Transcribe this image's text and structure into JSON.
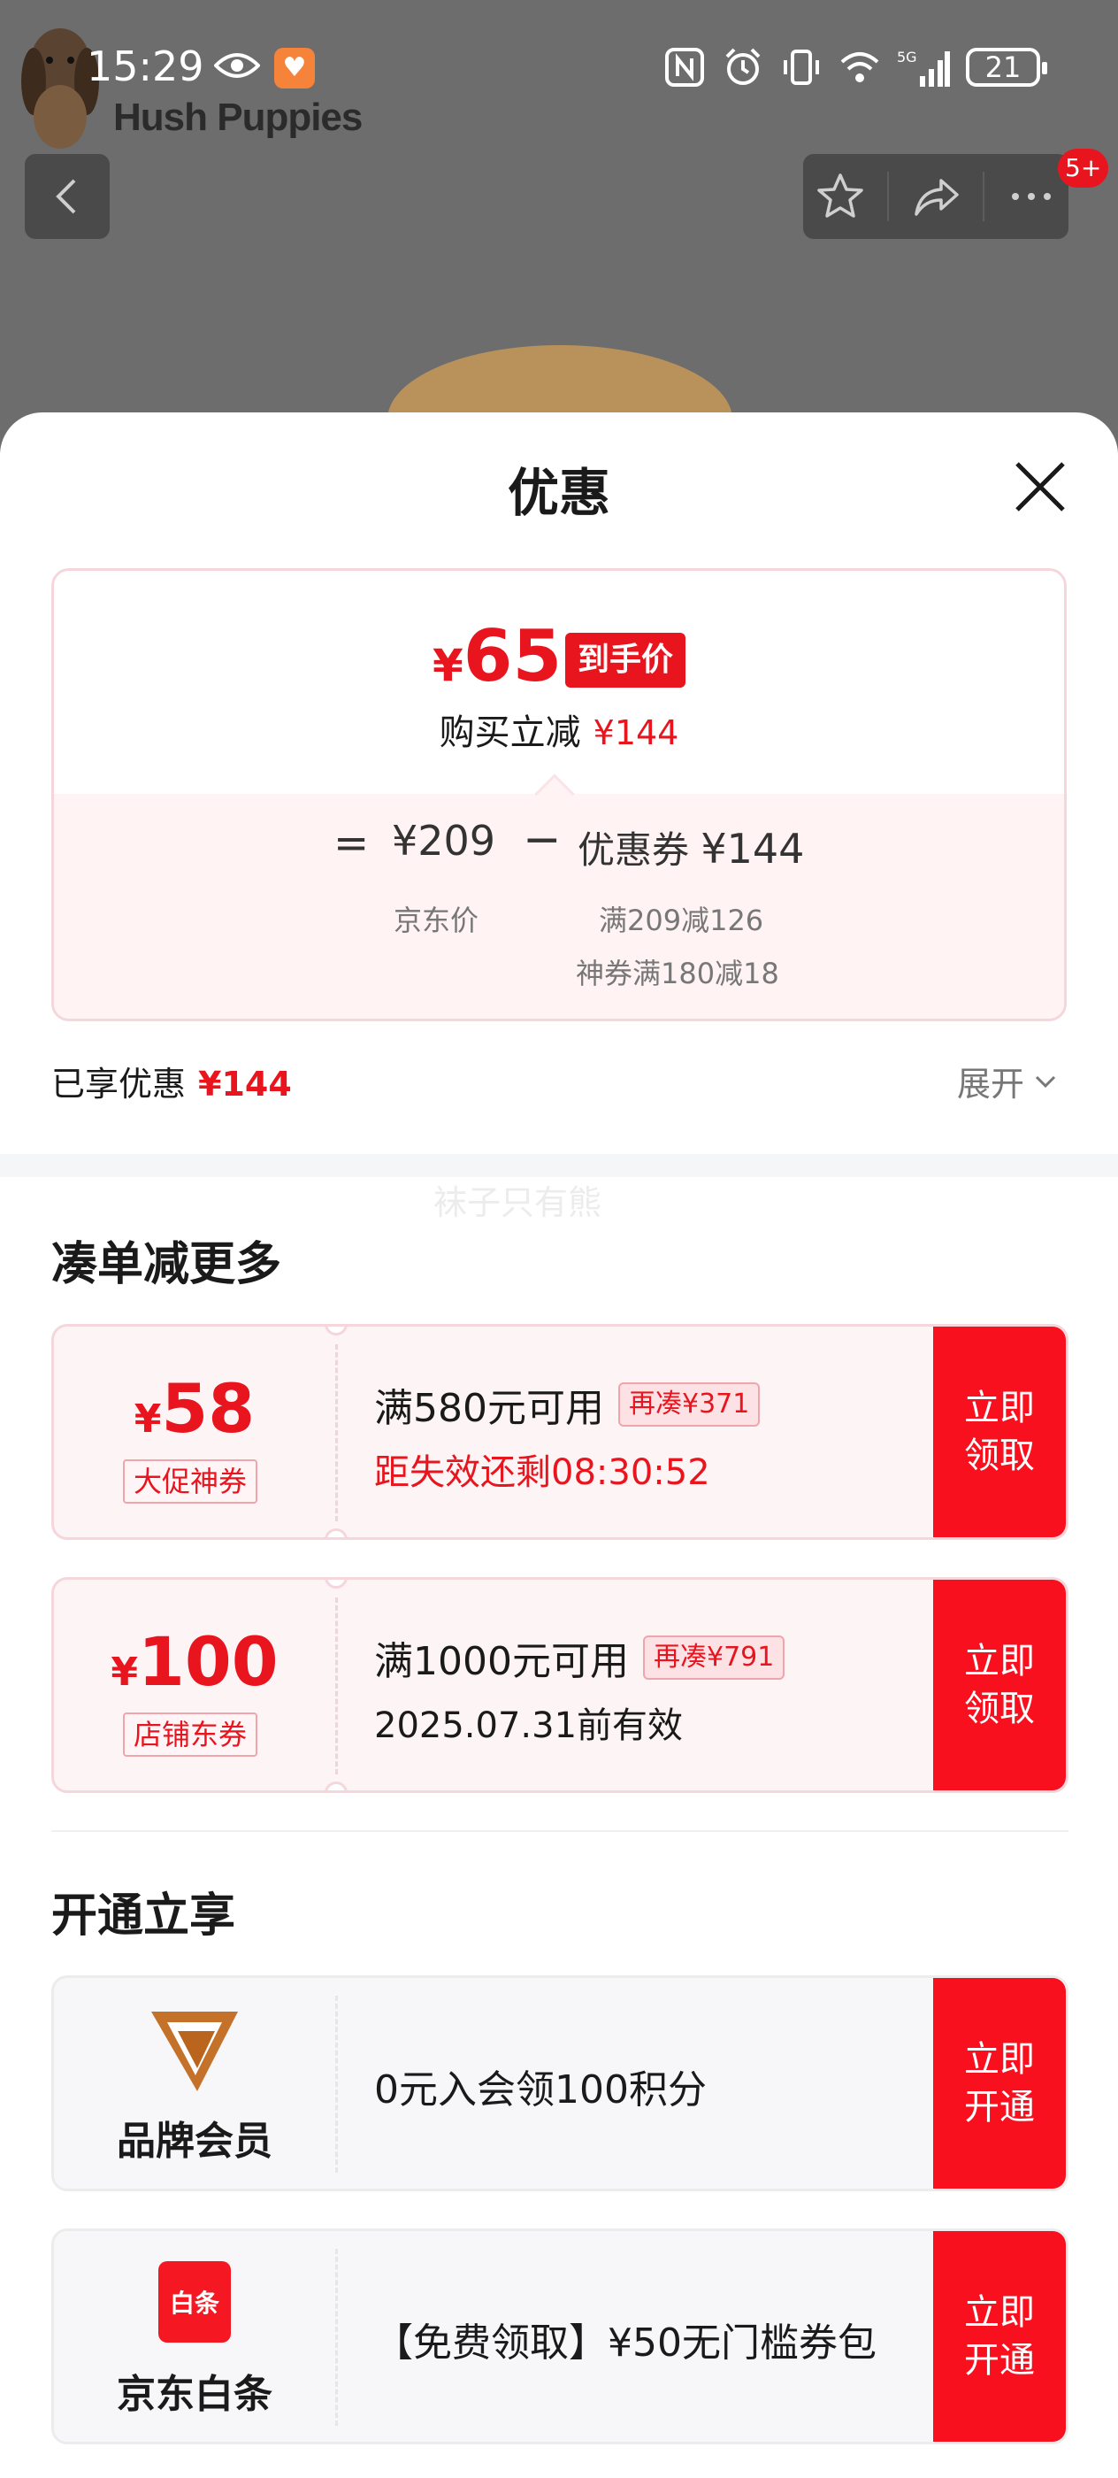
{
  "status_bar": {
    "time": "15:29",
    "battery": "21",
    "icons": [
      "eye-icon",
      "app-notification-icon",
      "nfc-icon",
      "alarm-icon",
      "vibrate-icon",
      "wifi-icon",
      "5g-signal-icon",
      "battery-icon"
    ]
  },
  "background": {
    "brand": "Hush Puppies",
    "notification_badge": "5+"
  },
  "sheet": {
    "title": "优惠",
    "price": {
      "currency": "¥",
      "final_value": "65",
      "final_tag": "到手价",
      "reduce_label": "购买立减",
      "reduce_value": "¥144",
      "equals": "=",
      "jd_price": "¥209",
      "minus": "−",
      "coupon_label": "优惠券",
      "coupon_value": "¥144",
      "jd_price_label": "京东价",
      "coupon_detail_1": "满209减126",
      "coupon_detail_2": "神券满180减18"
    },
    "enjoyed_label": "已享优惠",
    "enjoyed_value": "¥144",
    "expand_label": "展开",
    "watermark": "袜子只有熊"
  },
  "section_more": {
    "title": "凑单减更多",
    "coupons": [
      {
        "currency": "¥",
        "amount": "58",
        "type": "大促神券",
        "condition": "满580元可用",
        "again": "再凑¥371",
        "note": "距失效还剩08:30:52",
        "cta_line1": "立即",
        "cta_line2": "领取"
      },
      {
        "currency": "¥",
        "amount": "100",
        "type": "店铺东券",
        "condition": "满1000元可用",
        "again": "再凑¥791",
        "note": "2025.07.31前有效",
        "cta_line1": "立即",
        "cta_line2": "领取"
      }
    ]
  },
  "section_open": {
    "title": "开通立享",
    "items": [
      {
        "name": "品牌会员",
        "description": "0元入会领100积分",
        "cta_line1": "立即",
        "cta_line2": "开通"
      },
      {
        "name": "京东白条",
        "logo_text": "白条",
        "description": "【免费领取】¥50无门槛券包",
        "cta_line1": "立即",
        "cta_line2": "开通"
      }
    ]
  },
  "colors": {
    "accent_red": "#e8151e",
    "cta_red": "#f8101f",
    "card_pink_border": "#f4d6db",
    "card_pink_bg": "#fdf4f5",
    "member_gold": "#b9651d"
  }
}
